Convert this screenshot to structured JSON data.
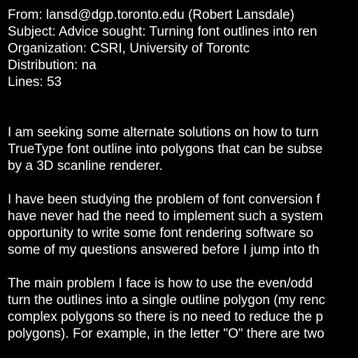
{
  "document": {
    "background_color": "#000000",
    "text_color": "#ffffff",
    "header": {
      "from": "From: lansd@dgp.toronto.edu (Robert Lansdale)",
      "subject": "Subject: Advice sought: Turning font outlines into ren",
      "organization": "Organization: CSRI, University of Torontc",
      "distribution": "Distribution: na",
      "lines": "Lines: 53"
    },
    "paragraphs": [
      [
        "I am seeking some alternate solutions on how to turn",
        "TrueType font outline into polygons that can be subse",
        "by a 3D scanline renderer."
      ],
      [
        "I have been studying the problem of font conversion f",
        "have never had the need to implement such a system",
        "opportunity to write some font rendering software so",
        "some of my questions answered before I jump into th"
      ],
      [
        "The main problem I face is how to use the even/odd",
        "turn the outlines into a single outline polygon (my renc",
        "complex polygons so there is no need to reduce the p",
        "polygons). For example, in the letter \"O\" there are two"
      ]
    ]
  }
}
